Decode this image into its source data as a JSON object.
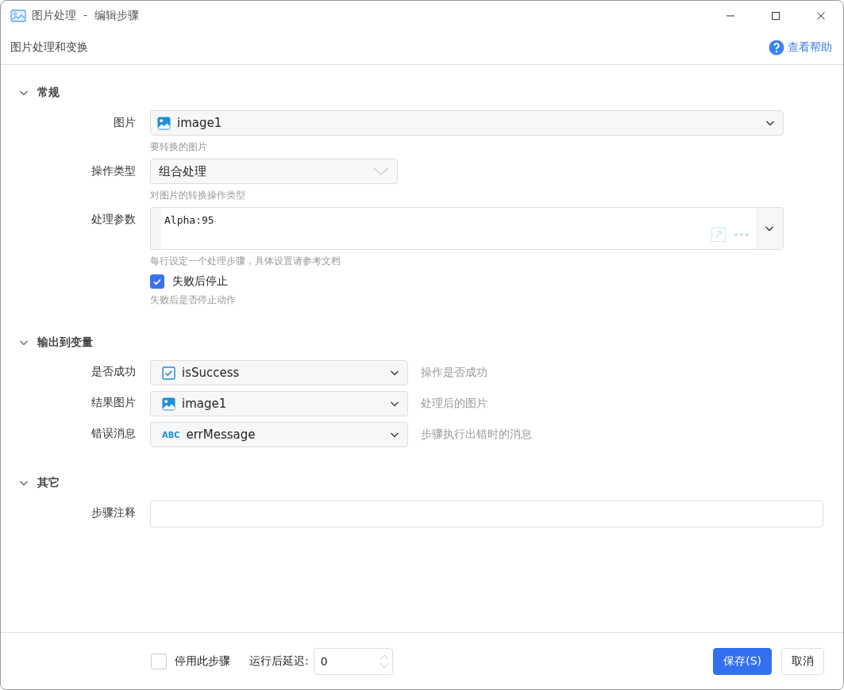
{
  "window": {
    "title": "图片处理  -  编辑步骤"
  },
  "header": {
    "subtitle": "图片处理和变换",
    "help_link": "查看帮助"
  },
  "sections": [
    {
      "title": "常规",
      "expanded": true,
      "fields": [
        {
          "kind": "variable_select",
          "label": "图片",
          "variable": {
            "kind": "image",
            "name": "image1"
          },
          "hint": "要转换的图片"
        },
        {
          "kind": "dropdown",
          "label": "操作类型",
          "value": "组合处理",
          "hint": "对图片的转换操作类型"
        },
        {
          "kind": "code_editor",
          "label": "处理参数",
          "value": "Alpha:95",
          "hint": "每行设定一个处理步骤，具体设置请参考文档"
        },
        {
          "kind": "checkbox",
          "label": "失败后停止",
          "checked": true,
          "hint": "失败后是否停止动作"
        }
      ]
    },
    {
      "title": "输出到变量",
      "expanded": true,
      "fields": [
        {
          "kind": "output_select",
          "label": "是否成功",
          "variable": {
            "kind": "bool",
            "name": "isSuccess"
          },
          "description": "操作是否成功"
        },
        {
          "kind": "output_select",
          "label": "结果图片",
          "variable": {
            "kind": "image",
            "name": "image1"
          },
          "description": "处理后的图片"
        },
        {
          "kind": "output_select",
          "label": "错误消息",
          "variable": {
            "kind": "text",
            "badge": "ABC",
            "name": "errMessage"
          },
          "description": "步骤执行出错时的消息"
        }
      ]
    },
    {
      "title": "其它",
      "expanded": true,
      "fields": [
        {
          "kind": "text_input",
          "label": "步骤注释"
        }
      ]
    }
  ],
  "footer": {
    "disable_step": {
      "label": "停用此步骤",
      "checked": false
    },
    "delay": {
      "label": "运行后延迟:",
      "value": "0"
    },
    "buttons": [
      {
        "label": "保存(S)",
        "primary": true
      },
      {
        "label": "取消",
        "primary": false
      }
    ]
  }
}
